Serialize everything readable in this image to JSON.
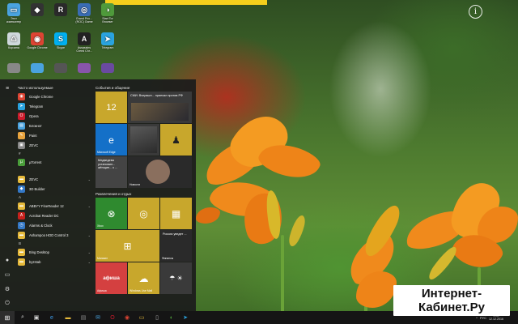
{
  "desktop": {
    "icons": [
      {
        "label": "Этот компьютер",
        "icon": "computer-icon",
        "color": "#4aa3df"
      },
      {
        "label": "",
        "icon": "tech-icon",
        "color": "#333333"
      },
      {
        "label": "",
        "icon": "game-icon",
        "color": "#2a2a2a"
      },
      {
        "label": "Grand Prix... (ROC) Game",
        "icon": "game-exe-icon",
        "color": "#3a6db5"
      },
      {
        "label": "Start Tor Browser",
        "icon": "tor-icon",
        "color": "#4f9a3b"
      },
      {
        "label": "Корзина",
        "icon": "recycle-bin-icon",
        "color": "#cfd8dc"
      },
      {
        "label": "Google Chrome",
        "icon": "chrome-icon",
        "color": "#dd4433"
      },
      {
        "label": "Skype",
        "icon": "skype-icon",
        "color": "#00aff0"
      },
      {
        "label": "Assassins Creed Chr...",
        "icon": "assassins-icon",
        "color": "#222222"
      },
      {
        "label": "Telegram",
        "icon": "telegram-icon",
        "color": "#2aa3df"
      }
    ],
    "info_glyph": "i"
  },
  "start_menu": {
    "frequent_title": "Часто используемые",
    "apps": [
      {
        "label": "Google Chrome",
        "icon": "chrome-icon",
        "color": "#dd4433"
      },
      {
        "label": "Telegram",
        "icon": "telegram-icon",
        "color": "#2aa3df"
      },
      {
        "label": "Opera",
        "icon": "opera-icon",
        "color": "#cc1b2b"
      },
      {
        "label": "Блокнот",
        "icon": "notepad-icon",
        "color": "#4aa3df"
      },
      {
        "label": "Paint",
        "icon": "paint-icon",
        "color": "#e8a33d"
      },
      {
        "label": "ZEVC",
        "icon": "zevc-icon",
        "color": "#888888"
      }
    ],
    "sections": [
      {
        "letter": "#",
        "apps": [
          {
            "label": "µTorrent",
            "icon": "utorrent-icon",
            "color": "#4a9e3a",
            "chevron": false
          }
        ]
      },
      {
        "letter": "",
        "apps": [
          {
            "label": "ZEVC",
            "icon": "folder-icon",
            "color": "#e5b93a",
            "chevron": true
          },
          {
            "label": "3D Builder",
            "icon": "builder-3d-icon",
            "color": "#3478c6",
            "chevron": false
          }
        ]
      },
      {
        "letter": "A",
        "apps": [
          {
            "label": "ABBYY FineReader 12",
            "icon": "folder-icon",
            "color": "#e5b93a",
            "chevron": true
          },
          {
            "label": "Acrobat Reader DC",
            "icon": "acrobat-icon",
            "color": "#c7201c",
            "chevron": false
          },
          {
            "label": "Alarms & Clock",
            "icon": "alarm-icon",
            "color": "#3478c6",
            "chevron": false
          },
          {
            "label": "Ashampoo HDD Control 3",
            "icon": "folder-icon",
            "color": "#e5b93a",
            "chevron": true
          }
        ]
      },
      {
        "letter": "B",
        "apps": [
          {
            "label": "Bing Desktop",
            "icon": "folder-icon",
            "color": "#e5b93a",
            "chevron": true
          },
          {
            "label": "byzstab",
            "icon": "folder-icon",
            "color": "#e5b93a",
            "chevron": true
          }
        ]
      }
    ],
    "tiles_group1_title": "События и общение",
    "tiles_group2_title": "Развлечения и отдых",
    "tiles": {
      "calendar_day": "12",
      "news_headline": "СМИ: Вчерашн... приехал против РФ",
      "edge_label": "Microsoft Edge",
      "news2_text": "Медведева установил... жёнщин... к ...",
      "news_label": "Новости",
      "xbox_label": "Xbox",
      "store_label": "Магазин",
      "russia_text": "Россия уведет ...",
      "finance_label": "Финансы",
      "afisha_label": "афиша",
      "afisha_sub": "Афиша",
      "weather_label": "Windows Live Mail",
      "colors": {
        "yellow": "#c8a72c",
        "green": "#2f8a2f",
        "blue": "#1470c8",
        "dark": "#3a3a3a",
        "red": "#d44040"
      }
    }
  },
  "taskbar": {
    "start_glyph": "⊞",
    "tray_lang": "РУС",
    "time": "0:00",
    "date": "12.12.2016"
  },
  "watermark": {
    "line1": "Интернет-",
    "line2": "Кабинет.Ру"
  }
}
